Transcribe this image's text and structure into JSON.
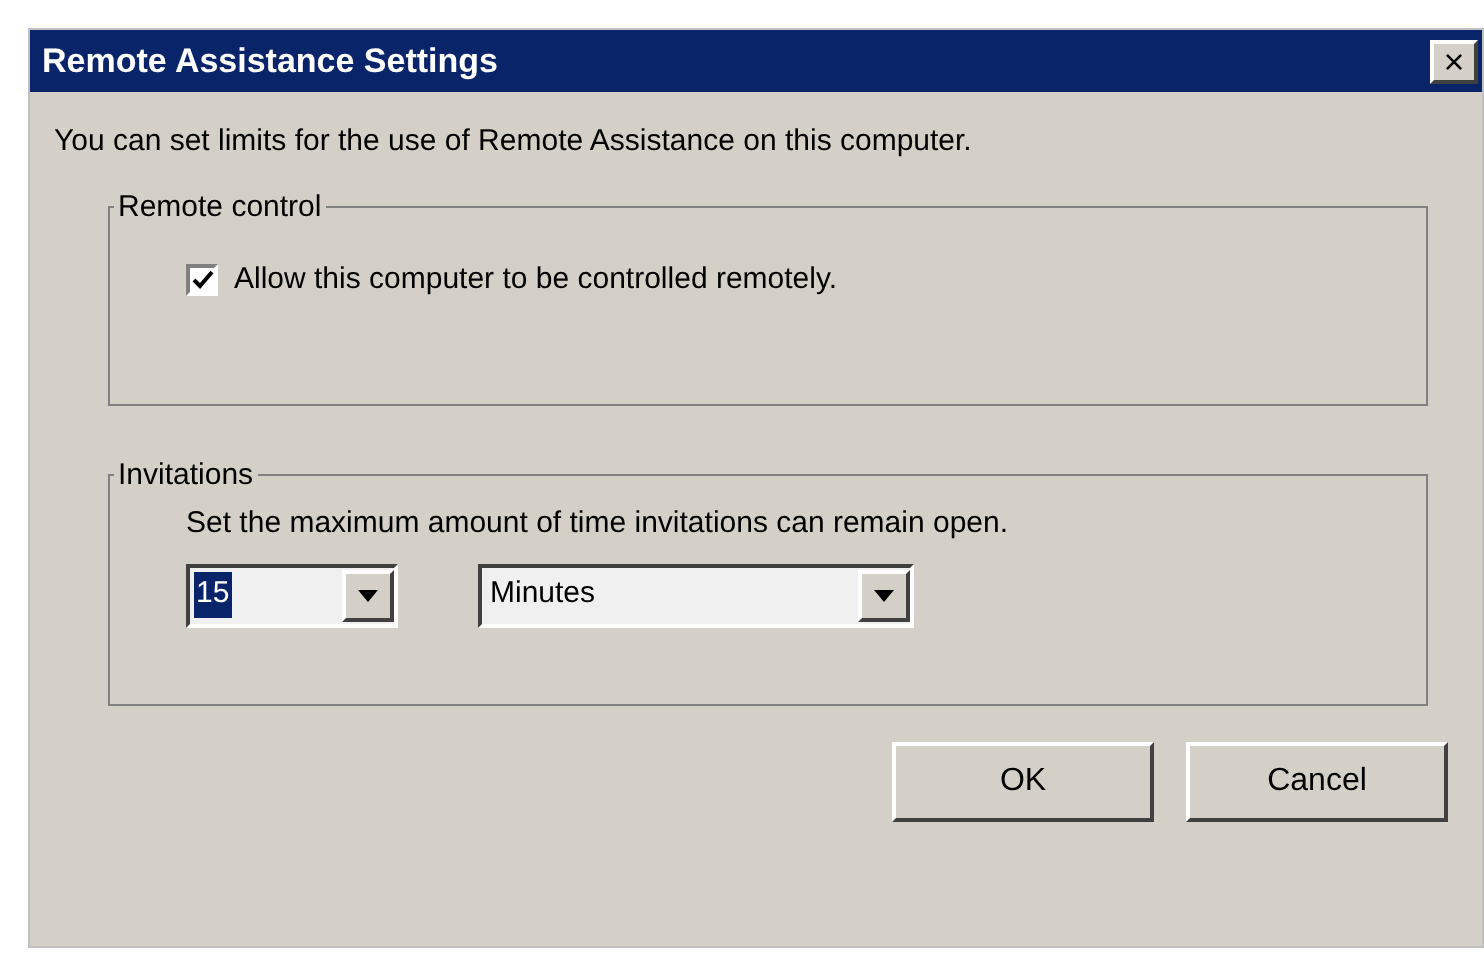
{
  "window": {
    "title": "Remote Assistance Settings",
    "close": "×"
  },
  "intro": "You can set limits for the use of Remote Assistance on this computer.",
  "remote_control": {
    "legend": "Remote control",
    "checkbox": {
      "label": "Allow this computer to be controlled remotely.",
      "checked": true
    }
  },
  "invitations": {
    "legend": "Invitations",
    "description": "Set the maximum amount of time invitations can remain open.",
    "amount": {
      "value": "15",
      "selected": true
    },
    "unit": {
      "value": "Minutes"
    }
  },
  "buttons": [
    "OK",
    "Cancel"
  ]
}
